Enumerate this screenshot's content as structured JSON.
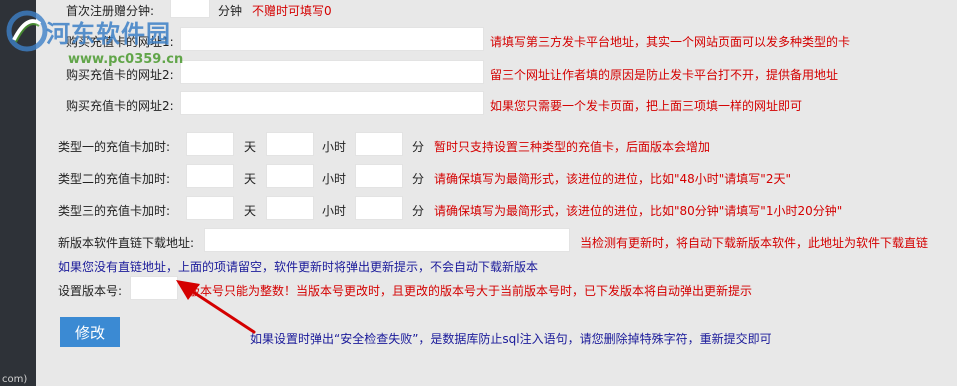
{
  "rows": {
    "first_bonus": {
      "label": "首次注册赠分钟:",
      "unit": "分钟",
      "hint": "不赠时可填写0"
    },
    "card_url_1": {
      "label": "购买充值卡的网址1:",
      "hint": "请填写第三方发卡平台地址，其实一个网站页面可以发多种类型的卡"
    },
    "card_url_2": {
      "label": "购买充值卡的网址2:",
      "hint": "留三个网址让作者填的原因是防止发卡平台打不开，提供备用地址"
    },
    "card_url_3": {
      "label": "购买充值卡的网址2:",
      "hint": "如果您只需要一个发卡页面，把上面三项填一样的网址即可"
    },
    "type1": {
      "label": "类型一的充值卡加时:",
      "hint": "暂时只支持设置三种类型的充值卡，后面版本会增加"
    },
    "type2": {
      "label": "类型二的充值卡加时:",
      "hint": "请确保填写为最简形式，该进位的进位，比如\"48小时\"请填写\"2天\""
    },
    "type3": {
      "label": "类型三的充值卡加时:",
      "hint": "请确保填写为最简形式，该进位的进位，比如\"80分钟\"请填写\"1小时20分钟\""
    },
    "download": {
      "label": "新版本软件直链下载地址:",
      "hint": "当检测有更新时，将自动下载新版本软件，此地址为软件下载直链"
    },
    "version": {
      "label": "设置版本号:",
      "hint": "版本号只能为整数！当版本号更改时，且更改的版本号大于当前版本号时，已下发版本将自动弹出更新提示"
    }
  },
  "units": {
    "day": "天",
    "hour": "小时",
    "minute": "分"
  },
  "notes": {
    "no_direct_link": "如果您没有直链地址，上面的项请留空，软件更新时将弹出更新提示，不会自动下载新版本",
    "security_check": "如果设置时弹出“安全检查失败”，是数据库防止sql注入语句，请您删除掉特殊字符，重新提交即可"
  },
  "submit_label": "修改",
  "watermark": {
    "title": "河东软件园",
    "url": "www.pc0359.cn"
  },
  "sidebar_fragment": "com)",
  "colors": {
    "hint_red": "#d40000",
    "hint_blue": "#1a1a9a",
    "button": "#3b8ad3",
    "sidebar": "#2e3238",
    "panel": "#e8e8e8"
  },
  "icons": {
    "watermark_logo": "swirl-logo-icon",
    "annotation_arrow": "red-arrow-icon"
  }
}
